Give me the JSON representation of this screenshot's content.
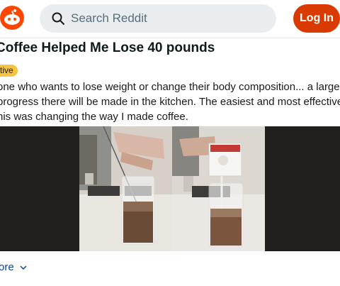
{
  "header": {
    "logo_icon": "reddit-snoo-icon",
    "search_placeholder": "Search Reddit",
    "login_label": "Log In"
  },
  "post": {
    "title": "Coffee Helped Me Lose 40 pounds",
    "flair": "tive",
    "body_lines": [
      "one who wants to lose weight or change their body composition... a large p",
      "progress there will be made in the kitchen. The easiest and most effective",
      "his was changing the way I made coffee."
    ],
    "read_more": "ore"
  },
  "colors": {
    "accent": "#d93a00",
    "brand": "#ff4500",
    "flair_bg": "#f5c542",
    "link": "#0a449b"
  }
}
